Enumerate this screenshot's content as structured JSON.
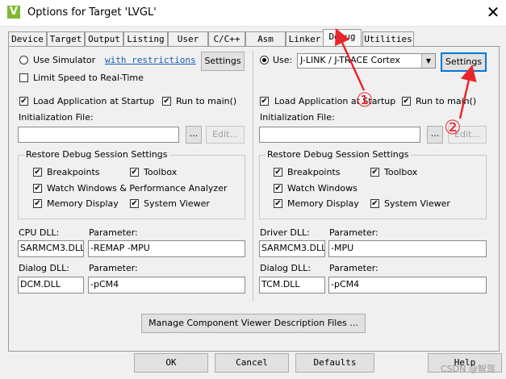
{
  "window": {
    "title": "Options for Target 'LVGL'",
    "close": "✕"
  },
  "tabs": [
    "Device",
    "Target",
    "Output",
    "Listing",
    "User",
    "C/C++",
    "Asm",
    "Linker",
    "Debug",
    "Utilities"
  ],
  "left": {
    "use_simulator": "Use Simulator",
    "with_restrictions": "with restrictions",
    "settings": "Settings",
    "limit_speed": "Limit Speed to Real-Time",
    "load_app": "Load Application at Startup",
    "run_main": "Run to main()",
    "init_file": "Initialization File:",
    "browse": "...",
    "edit": "Edit...",
    "restore_title": "Restore Debug Session Settings",
    "breakpoints": "Breakpoints",
    "toolbox": "Toolbox",
    "watch": "Watch Windows & Performance Analyzer",
    "memory": "Memory Display",
    "system_viewer": "System Viewer",
    "cpu_dll_label": "CPU DLL:",
    "cpu_param_label": "Parameter:",
    "cpu_dll": "SARMCM3.DLL",
    "cpu_param": "-REMAP -MPU",
    "dialog_dll_label": "Dialog DLL:",
    "dialog_param_label": "Parameter:",
    "dialog_dll": "DCM.DLL",
    "dialog_param": "-pCM4"
  },
  "right": {
    "use": "Use:",
    "driver": "J-LINK / J-TRACE Cortex",
    "settings": "Settings",
    "load_app": "Load Application at Startup",
    "run_main": "Run to main()",
    "init_file": "Initialization File:",
    "browse": "...",
    "edit": "Edit...",
    "restore_title": "Restore Debug Session Settings",
    "breakpoints": "Breakpoints",
    "toolbox": "Toolbox",
    "watch": "Watch Windows",
    "memory": "Memory Display",
    "system_viewer": "System Viewer",
    "driver_dll_label": "Driver DLL:",
    "driver_param_label": "Parameter:",
    "driver_dll": "SARMCM3.DLL",
    "driver_param": "-MPU",
    "dialog_dll_label": "Dialog DLL:",
    "dialog_param_label": "Parameter:",
    "dialog_dll": "TCM.DLL",
    "dialog_param": "-pCM4"
  },
  "manage_btn": "Manage Component Viewer Description Files ...",
  "bottom": {
    "ok": "OK",
    "cancel": "Cancel",
    "defaults": "Defaults",
    "help": "Help"
  },
  "annotations": {
    "one": "①",
    "two": "②"
  },
  "watermark": "CSDN @智驾",
  "accent_red": "#e8272b"
}
